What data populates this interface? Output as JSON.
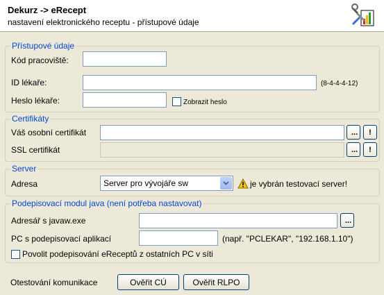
{
  "header": {
    "title": "Dekurz -> eRecept",
    "subtitle": "nastavení elektronického receptu - přístupové údaje"
  },
  "access": {
    "legend": "Přístupové údaje",
    "workplace_code_label": "Kód pracoviště:",
    "workplace_code_value": "",
    "doctor_id_label": "ID lékaře:",
    "doctor_id_value": "",
    "doctor_id_hint": "(8-4-4-4-12)",
    "doctor_password_label": "Heslo lékaře:",
    "doctor_password_value": "",
    "show_password_label": "Zobrazit heslo",
    "show_password_checked": false
  },
  "certificates": {
    "legend": "Certifikáty",
    "personal_label": "Váš osobní certifikát",
    "personal_value": "",
    "ssl_label": "SSL certifikát",
    "ssl_value": "",
    "browse_label": "...",
    "info_label": "!"
  },
  "server": {
    "legend": "Server",
    "address_label": "Adresa",
    "selected": "Server pro vývojáře sw",
    "warning_text": "je vybrán testovací server!"
  },
  "signing": {
    "legend": "Podepisovací modul java (není potřeba nastavovat)",
    "javaw_dir_label": "Adresář s javaw.exe",
    "javaw_dir_value": "",
    "browse_label": "...",
    "pc_label": "PC s podepisovací aplikací",
    "pc_value": "",
    "pc_hint": "(např. \"PCLEKAR\", \"192.168.1.10\")",
    "allow_remote_label": "Povolit podepisování eReceptů z ostatních PC v síti",
    "allow_remote_checked": false
  },
  "communication": {
    "label": "Otestování komunikace",
    "verify_cu_button": "Ověřit CÚ",
    "verify_rlpo_button": "Ověřit RLPO"
  },
  "colors": {
    "legend": "#0046d5",
    "background": "#ece9d8",
    "warning": "#f5c400"
  }
}
